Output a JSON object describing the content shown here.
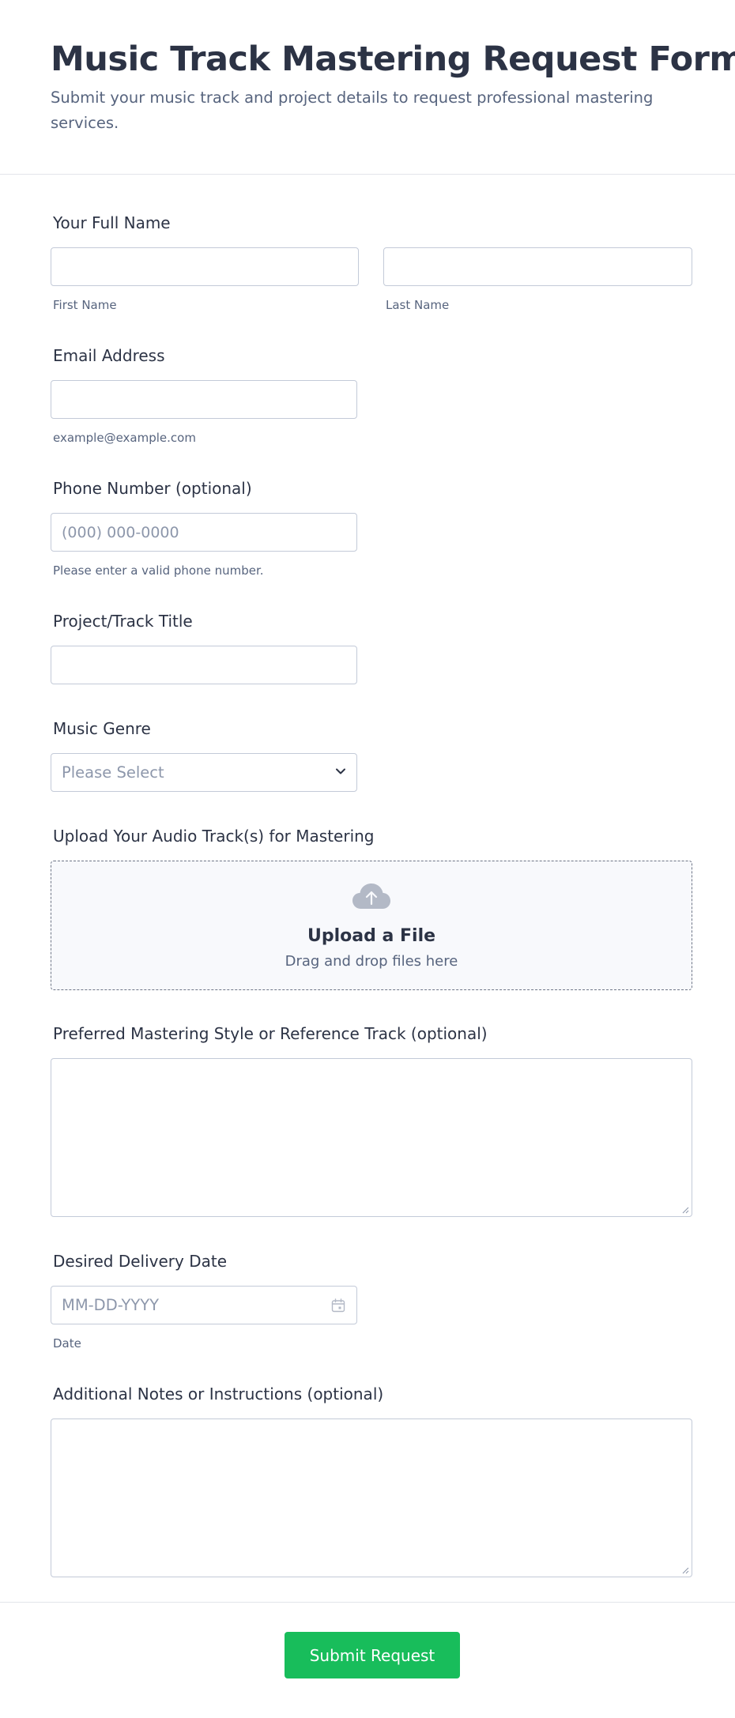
{
  "header": {
    "title": "Music Track Mastering Request Form",
    "subtitle": "Submit your music track and project details to request professional mastering services."
  },
  "fields": {
    "full_name": {
      "label": "Your Full Name",
      "first_sublabel": "First Name",
      "last_sublabel": "Last Name",
      "first_value": "",
      "last_value": ""
    },
    "email": {
      "label": "Email Address",
      "sublabel": "example@example.com",
      "value": ""
    },
    "phone": {
      "label": "Phone Number (optional)",
      "placeholder": "(000) 000-0000",
      "sublabel": "Please enter a valid phone number.",
      "value": ""
    },
    "title": {
      "label": "Project/Track Title",
      "value": ""
    },
    "genre": {
      "label": "Music Genre",
      "selected": "Please Select"
    },
    "upload": {
      "label": "Upload Your Audio Track(s) for Mastering",
      "title": "Upload a File",
      "hint": "Drag and drop files here",
      "icon": "cloud-upload-icon"
    },
    "style": {
      "label": "Preferred Mastering Style or Reference Track (optional)",
      "value": ""
    },
    "delivery_date": {
      "label": "Desired Delivery Date",
      "placeholder": "MM-DD-YYYY",
      "sublabel": "Date",
      "icon": "calendar-icon"
    },
    "notes": {
      "label": "Additional Notes or Instructions (optional)",
      "value": ""
    }
  },
  "submit": {
    "label": "Submit Request",
    "color": "#18bd5b"
  },
  "colors": {
    "text": "#2c3345",
    "muted": "#57647e",
    "placeholder": "#8d97ab",
    "border": "#c3cad8"
  }
}
